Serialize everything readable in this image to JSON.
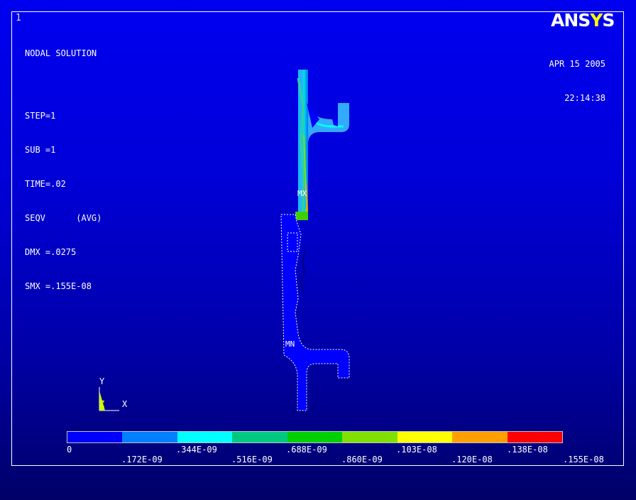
{
  "window_number": "1",
  "info": {
    "line1": "NODAL SOLUTION",
    "line2": "STEP=1",
    "line3": "SUB =1",
    "line4": "TIME=.02",
    "line5": "SEQV      (AVG)",
    "line6": "DMX =.0275",
    "line7": "SMX =.155E-08"
  },
  "logo": {
    "main": "ANS",
    "accent": "Y",
    "tail": "S"
  },
  "date": {
    "day": "APR 15 2005",
    "time": "22:14:38"
  },
  "model_labels": {
    "max": "MX",
    "min": "MN"
  },
  "triad": {
    "y": "Y",
    "z": "Z",
    "x": "X"
  },
  "legend": {
    "colors": [
      "#0000ff",
      "#0080ff",
      "#00ffff",
      "#00c880",
      "#00d000",
      "#80e000",
      "#ffff00",
      "#ffa000",
      "#ff0000"
    ],
    "labels_top": [
      "0",
      ".344E-09",
      ".688E-09",
      ".103E-08",
      ".138E-08"
    ],
    "labels_bottom": [
      ".172E-09",
      ".516E-09",
      ".860E-09",
      ".120E-08",
      ".155E-08"
    ]
  }
}
